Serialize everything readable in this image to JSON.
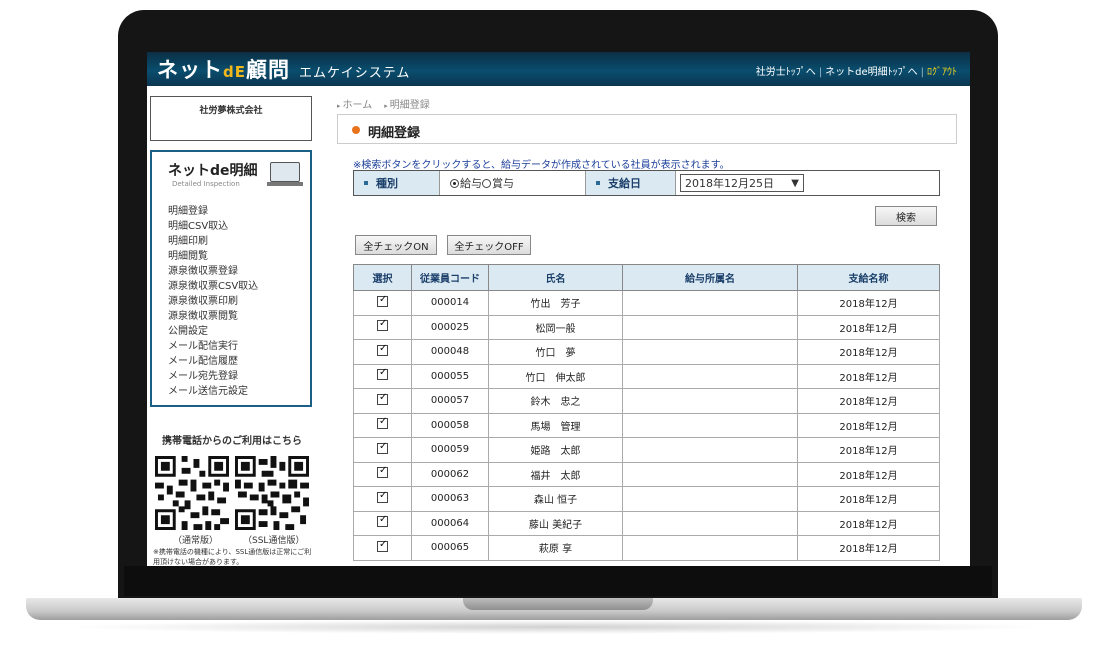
{
  "header": {
    "logo_main": "ネット",
    "logo_de": "dE",
    "logo_tail": "顧問",
    "company": "エムケイシステム",
    "links": [
      "社労士ﾄｯﾌﾟへ",
      "ネットde明細ﾄｯﾌﾟへ"
    ],
    "logout": "ﾛｸﾞｱｳﾄ"
  },
  "sidebar": {
    "company_name": "社労夢株式会社",
    "menu_title": "ネットde明細",
    "menu_subtitle": "Detailed Inspection",
    "items": [
      "明細登録",
      "明細CSV取込",
      "明細印刷",
      "明細閲覧",
      "源泉徴収票登録",
      "源泉徴収票CSV取込",
      "源泉徴収票印刷",
      "源泉徴収票閲覧",
      "公開設定",
      "メール配信実行",
      "メール配信履歴",
      "メール宛先登録",
      "メール送信元設定"
    ],
    "qr_title": "携帯電話からのご利用はこちら",
    "qr_labels": [
      "（通常版）",
      "（SSL通信版）"
    ],
    "qr_note": "※携帯電話の機種により、SSL通信版は正常にご利用頂けない場合があります。"
  },
  "breadcrumb": [
    "ホーム",
    "明細登録"
  ],
  "page_title": "明細登録",
  "notice": "※検索ボタンをクリックすると、給与データが作成されている社員が表示されます。",
  "filter": {
    "type_label": "種別",
    "radio_salary": "給与",
    "radio_bonus": "賞与",
    "selected": "給与",
    "date_label": "支給日",
    "date_value": "2018年12月25日"
  },
  "buttons": {
    "search": "検索",
    "check_all_on": "全チェックON",
    "check_all_off": "全チェックOFF"
  },
  "table": {
    "columns": [
      "選択",
      "従業員コード",
      "氏名",
      "給与所属名",
      "支給名称"
    ],
    "rows": [
      {
        "code": "000014",
        "name": "竹出　芳子",
        "dept": "",
        "pay": "2018年12月"
      },
      {
        "code": "000025",
        "name": "松岡一般",
        "dept": "",
        "pay": "2018年12月"
      },
      {
        "code": "000048",
        "name": "竹口　夢",
        "dept": "",
        "pay": "2018年12月"
      },
      {
        "code": "000055",
        "name": "竹口　伸太郎",
        "dept": "",
        "pay": "2018年12月"
      },
      {
        "code": "000057",
        "name": "鈴木　忠之",
        "dept": "",
        "pay": "2018年12月"
      },
      {
        "code": "000058",
        "name": "馬場　管理",
        "dept": "",
        "pay": "2018年12月"
      },
      {
        "code": "000059",
        "name": "姫路　太郎",
        "dept": "",
        "pay": "2018年12月"
      },
      {
        "code": "000062",
        "name": "福井　太郎",
        "dept": "",
        "pay": "2018年12月"
      },
      {
        "code": "000063",
        "name": "森山 恒子",
        "dept": "",
        "pay": "2018年12月"
      },
      {
        "code": "000064",
        "name": "藤山 美紀子",
        "dept": "",
        "pay": "2018年12月"
      },
      {
        "code": "000065",
        "name": "萩原 享",
        "dept": "",
        "pay": "2018年12月"
      }
    ]
  }
}
